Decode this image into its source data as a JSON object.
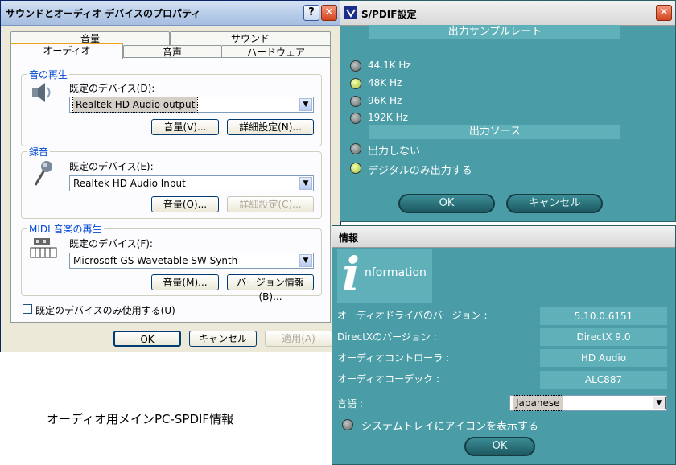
{
  "sound_dialog": {
    "title": "サウンドとオーディオ デバイスのプロパティ",
    "help_btn": "?",
    "close_btn": "✕",
    "tabs_top": [
      "音量",
      "サウンド"
    ],
    "tabs_bottom": [
      "オーディオ",
      "音声",
      "ハードウェア"
    ],
    "playback": {
      "group": "音の再生",
      "label": "既定のデバイス(D):",
      "device": "Realtek HD Audio output",
      "volume_btn": "音量(V)...",
      "advanced_btn": "詳細設定(N)..."
    },
    "recording": {
      "group": "録音",
      "label": "既定のデバイス(E):",
      "device": "Realtek HD Audio Input",
      "volume_btn": "音量(O)...",
      "advanced_btn": "詳細設定(C)..."
    },
    "midi": {
      "group": "MIDI 音楽の再生",
      "label": "既定のデバイス(F):",
      "device": "Microsoft GS Wavetable SW Synth",
      "volume_btn": "音量(M)...",
      "version_btn": "バージョン情報(B)..."
    },
    "only_default": "既定のデバイスのみ使用する(U)",
    "ok": "OK",
    "cancel": "キャンセル",
    "apply": "適用(A)"
  },
  "spdif": {
    "title": "S/PDIF設定",
    "close_btn": "✕",
    "rate_header": "出力サンプルレート",
    "rates": [
      {
        "label": "44.1K Hz",
        "on": false
      },
      {
        "label": "48K Hz",
        "on": true
      },
      {
        "label": "96K Hz",
        "on": false
      },
      {
        "label": "192K Hz",
        "on": false
      }
    ],
    "source_header": "出力ソース",
    "sources": [
      {
        "label": "出力しない",
        "on": false
      },
      {
        "label": "デジタルのみ出力する",
        "on": true
      }
    ],
    "ok": "OK",
    "cancel": "キャンセル"
  },
  "info": {
    "title": "情報",
    "logo_i": "i",
    "logo_text": "nformation",
    "rows": [
      {
        "label": "オーディオドライバのバージョン :",
        "value": "5.10.0.6151"
      },
      {
        "label": "DirectXのバージョン :",
        "value": "DirectX 9.0"
      },
      {
        "label": "オーディオコントローラ :",
        "value": "HD Audio"
      },
      {
        "label": "オーディオコーデック :",
        "value": "ALC887"
      }
    ],
    "language_label": "言語 :",
    "language_value": "Japanese",
    "tray_label": "システムトレイにアイコンを表示する",
    "ok": "OK"
  },
  "caption": "オーディオ用メインPC-SPDIF情報"
}
